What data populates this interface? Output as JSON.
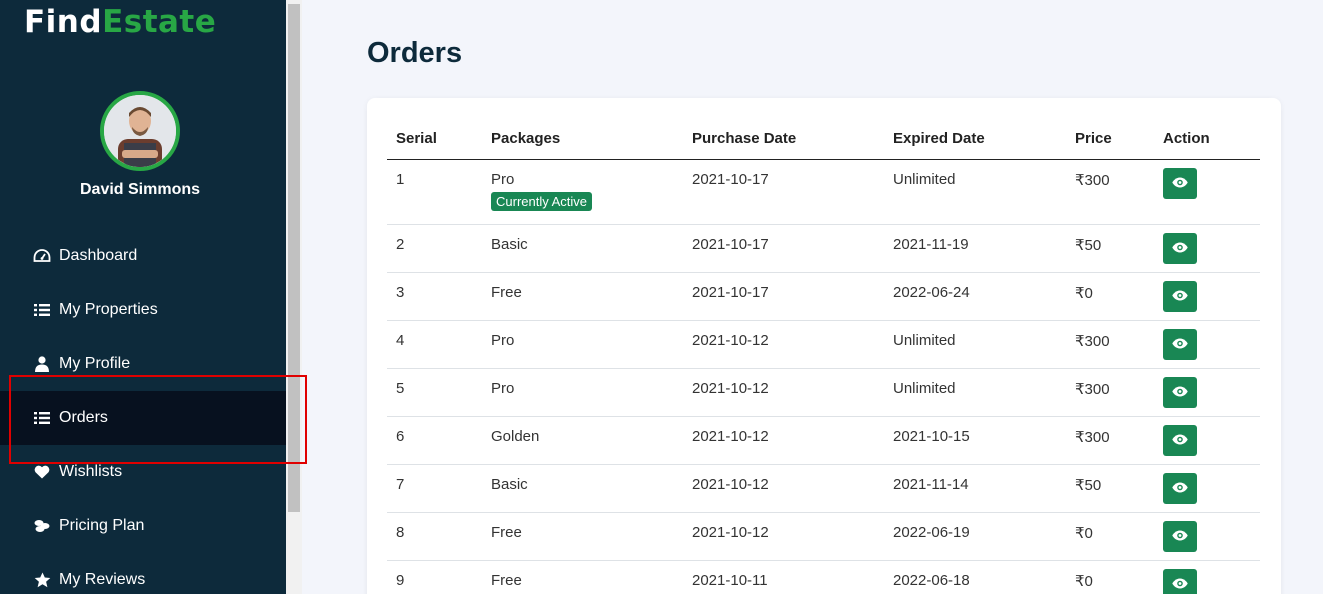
{
  "brand": {
    "part1": "Find",
    "part2": "Estate"
  },
  "user": {
    "name": "David Simmons"
  },
  "sidebar": {
    "items": [
      {
        "label": "Dashboard",
        "icon": "dashboard-icon"
      },
      {
        "label": "My Properties",
        "icon": "list-icon"
      },
      {
        "label": "My Profile",
        "icon": "user-icon"
      },
      {
        "label": "Orders",
        "icon": "list-icon",
        "active": true
      },
      {
        "label": "Wishlists",
        "icon": "heart-icon"
      },
      {
        "label": "Pricing Plan",
        "icon": "coins-icon"
      },
      {
        "label": "My Reviews",
        "icon": "star-icon"
      }
    ]
  },
  "page": {
    "title": "Orders"
  },
  "table": {
    "headers": [
      "Serial",
      "Packages",
      "Purchase Date",
      "Expired Date",
      "Price",
      "Action"
    ],
    "active_badge": "Currently Active",
    "rows": [
      {
        "serial": "1",
        "package": "Pro",
        "purchase": "2021-10-17",
        "expired": "Unlimited",
        "price": "₹300"
      },
      {
        "serial": "2",
        "package": "Basic",
        "purchase": "2021-10-17",
        "expired": "2021-11-19",
        "price": "₹50"
      },
      {
        "serial": "3",
        "package": "Free",
        "purchase": "2021-10-17",
        "expired": "2022-06-24",
        "price": "₹0"
      },
      {
        "serial": "4",
        "package": "Pro",
        "purchase": "2021-10-12",
        "expired": "Unlimited",
        "price": "₹300"
      },
      {
        "serial": "5",
        "package": "Pro",
        "purchase": "2021-10-12",
        "expired": "Unlimited",
        "price": "₹300"
      },
      {
        "serial": "6",
        "package": "Golden",
        "purchase": "2021-10-12",
        "expired": "2021-10-15",
        "price": "₹300"
      },
      {
        "serial": "7",
        "package": "Basic",
        "purchase": "2021-10-12",
        "expired": "2021-11-14",
        "price": "₹50"
      },
      {
        "serial": "8",
        "package": "Free",
        "purchase": "2021-10-12",
        "expired": "2022-06-19",
        "price": "₹0"
      },
      {
        "serial": "9",
        "package": "Free",
        "purchase": "2021-10-11",
        "expired": "2022-06-18",
        "price": "₹0"
      }
    ]
  },
  "colors": {
    "sidebar_bg": "#0d2a3b",
    "accent": "#28a745",
    "button": "#198754",
    "highlight": "#e00000"
  }
}
